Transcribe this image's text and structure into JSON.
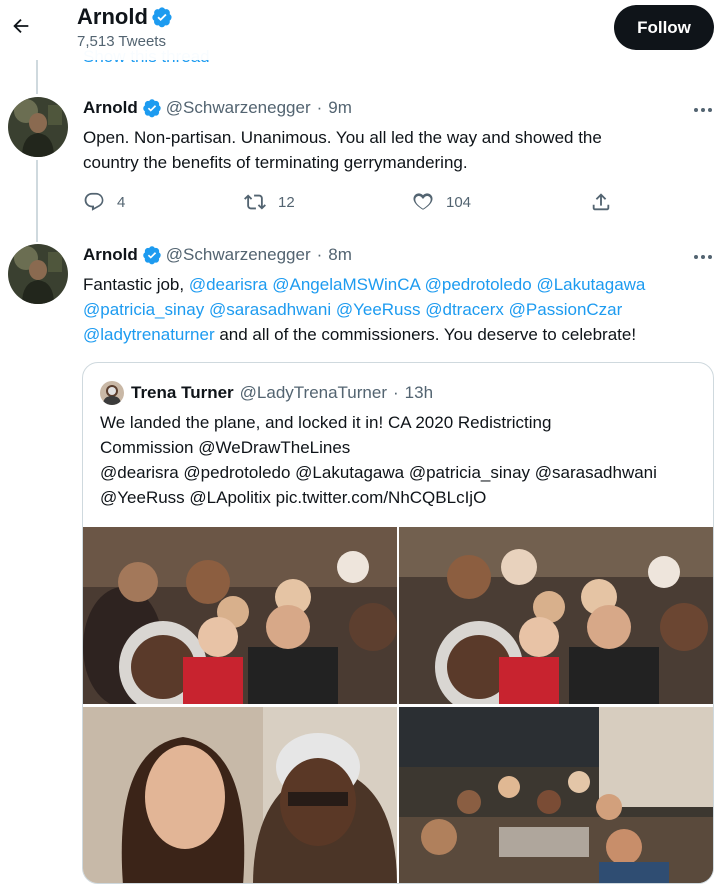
{
  "header": {
    "name": "Arnold",
    "tweet_count": "7,513 Tweets",
    "follow_label": "Follow"
  },
  "show_thread_label": "Show this thread",
  "tweets": [
    {
      "name": "Arnold",
      "handle": "@Schwarzenegger",
      "time": "9m",
      "text_lines": [
        "Open. Non-partisan. Unanimous. You all led the way and showed the",
        "country the benefits of terminating gerrymandering."
      ],
      "replies": "4",
      "retweets": "12",
      "likes": "104"
    },
    {
      "name": "Arnold",
      "handle": "@Schwarzenegger",
      "time": "8m",
      "text_prefix": "Fantastic job, ",
      "mentions_line1": [
        "@dearisra",
        "@AngelaMSWinCA",
        "@pedrotoledo",
        "@Lakutagawa"
      ],
      "mentions_line2": [
        "@patricia_sinay",
        "@sarasadhwani",
        "@YeeRuss",
        "@dtracerx",
        "@PassionCzar"
      ],
      "mention_line3": "@ladytrenaturner",
      "text_suffix": " and all of the commissioners. You deserve to celebrate!"
    }
  ],
  "quote": {
    "name": "Trena Turner",
    "handle": "@LadyTrenaTurner",
    "time": "13h",
    "lines": [
      "We landed the plane, and locked it in! CA 2020 Redistricting",
      "Commission @WeDrawTheLines",
      "@dearisra @pedrotoledo @Lakutagawa @patricia_sinay @sarasadhwani",
      "@YeeRuss  @LApolitix pic.twitter.com/NhCQBLcIjO"
    ]
  },
  "separator_dot": "·",
  "icons": {
    "back": "back-arrow-icon",
    "verified": "verified-badge-icon",
    "more": "more-icon",
    "reply": "reply-icon",
    "retweet": "retweet-icon",
    "like": "like-icon",
    "share": "share-icon"
  },
  "colors": {
    "accent": "#1d9bf0",
    "text": "#0f1419",
    "muted": "#536471",
    "follow_bg": "#0f1419"
  }
}
